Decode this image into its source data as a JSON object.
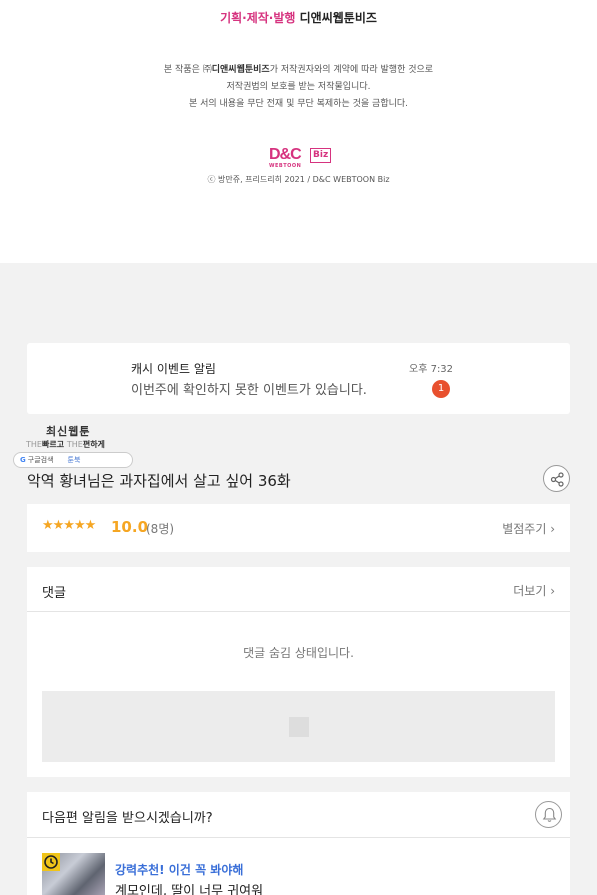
{
  "credits": {
    "planning_pink": "기획·제작·발행",
    "planning_company": " 디앤씨웹툰비즈",
    "notice_prefix": "본 작품은 ㈜",
    "notice_company": "디앤씨웹툰비즈",
    "notice_line1_suffix": "가 저작권자와의 계약에 따라 발행한 것으로",
    "notice_line2": "저작권법의 보호를 받는 저작물입니다.",
    "notice_line3": "본 서의 내용을 무단 전재 및 무단 복제하는 것을 금합니다.",
    "logo_dc": "D&C",
    "logo_webtoon": "WEBTOON",
    "logo_biz": "Biz",
    "copyright": "ⓒ 방만쥬, 프리드리히 2021 / D&C WEBTOON Biz"
  },
  "notification": {
    "title": "캐시 이벤트 알림",
    "message": "이번주에 확인하지 못한 이벤트가 있습니다.",
    "time": "오후 7:32",
    "badge": "1"
  },
  "mini_logo": {
    "main": "최신웹툰",
    "the1": "THE",
    "fast": "빠르고",
    "the2": "THE",
    "easy": "편하게",
    "google_g": "G",
    "google_search": "구글검색",
    "toonbook": "툰북"
  },
  "episode": {
    "title": "악역 황녀님은 과자집에서 살고 싶어 36화"
  },
  "rating": {
    "stars": "★★★★★",
    "score": "10.0",
    "count": "(8명)",
    "rate_button": "별점주기 ›"
  },
  "comments": {
    "label": "댓글",
    "more": "더보기 ›",
    "hidden_message": "댓글 숨김 상태입니다."
  },
  "next_alert": {
    "label": "다음편 알림을 받으시겠습니까?",
    "rec_title": "강력추천! 이건 꼭 봐야해",
    "rec_desc": "계모인데, 딸이 너무 귀여워"
  },
  "colors": {
    "brand_pink": "#d6337f",
    "star": "#f5a623",
    "badge": "#e8502e",
    "link_blue": "#3a6fd8"
  }
}
